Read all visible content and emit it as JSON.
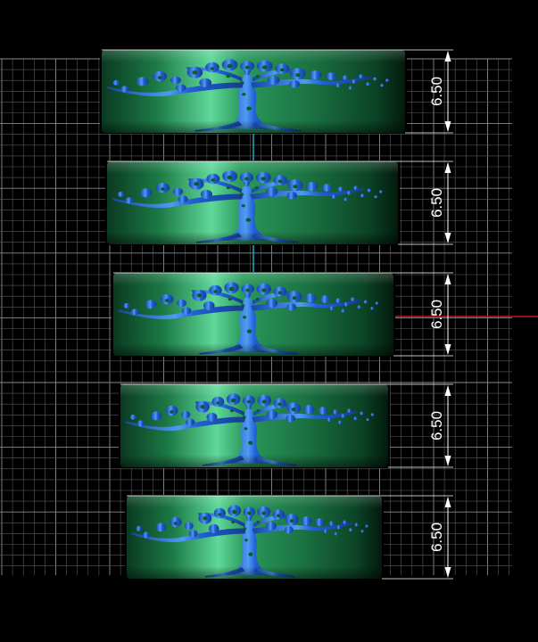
{
  "viewport": {
    "background": "#000000",
    "grid_color": "#5a5a5a",
    "grid_major_color": "#8a8a8a",
    "axis_y_color": "#1aa7c4",
    "axis_x_color": "#c41a1a",
    "dimension_color": "#ffffff"
  },
  "ring": {
    "band_color_dark": "#0a3a22",
    "band_color_mid": "#1f8a4e",
    "band_color_light": "#63d99a",
    "tree_color": "#1e5fd6",
    "tree_highlight": "#6fb0ff"
  },
  "rings": [
    {
      "label": "6.50"
    },
    {
      "label": "6.50"
    },
    {
      "label": "6.50"
    },
    {
      "label": "6.50"
    },
    {
      "label": "6.50"
    }
  ]
}
